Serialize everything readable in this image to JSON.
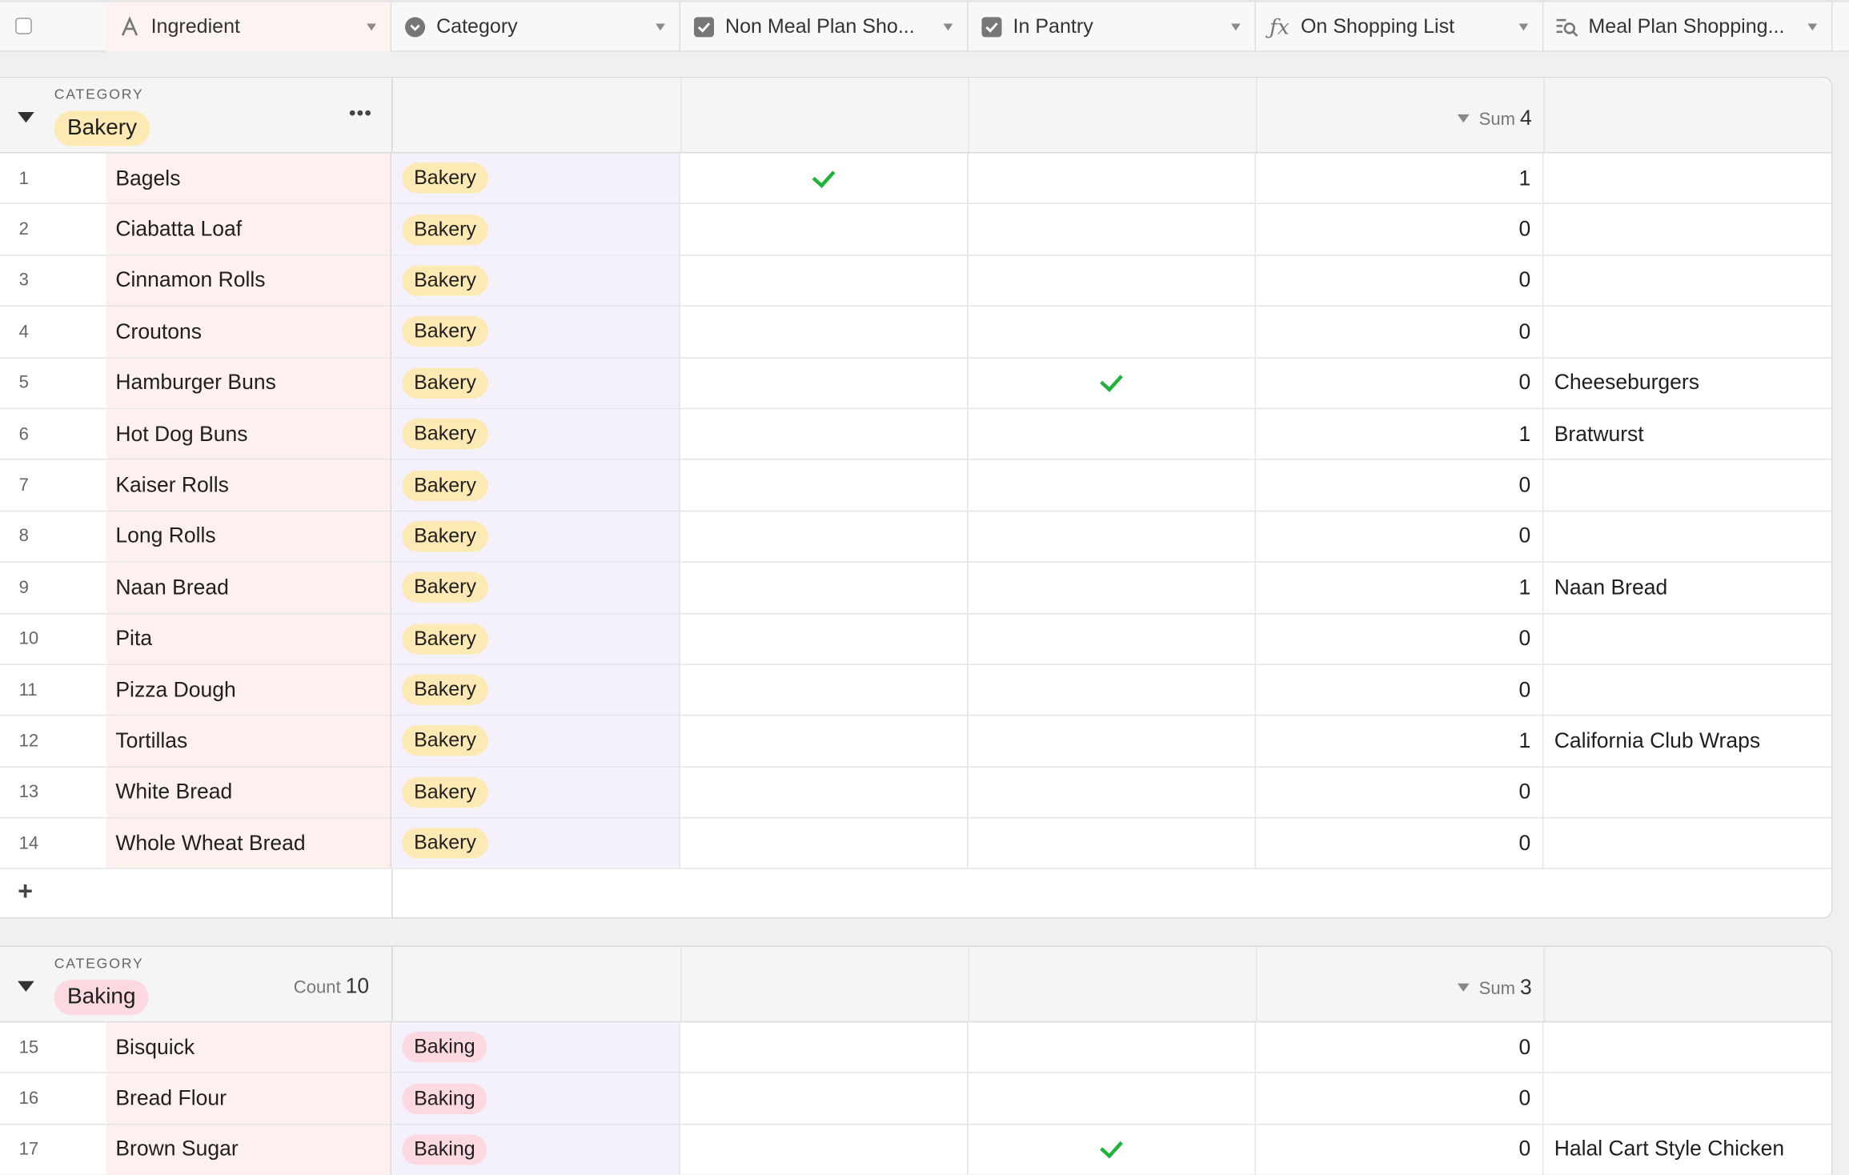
{
  "header": {
    "columns": [
      {
        "label": "Ingredient",
        "icon": "text-field-icon"
      },
      {
        "label": "Category",
        "icon": "single-select-icon"
      },
      {
        "label": "Non Meal Plan Sho...",
        "icon": "checkbox-field-icon"
      },
      {
        "label": "In Pantry",
        "icon": "checkbox-field-icon"
      },
      {
        "label": "On Shopping List",
        "icon": "formula-icon"
      },
      {
        "label": "Meal Plan Shopping...",
        "icon": "lookup-icon"
      }
    ]
  },
  "colors": {
    "bakery_pill": "#fde9b3",
    "baking_pill": "#fcd9e0",
    "check": "#20b33a"
  },
  "groups": [
    {
      "category_label": "CATEGORY",
      "name": "Bakery",
      "pill_color": "#fde9b3",
      "more": "•••",
      "count_label": "",
      "count_value": "",
      "sum_label": "Sum",
      "sum_value": "4",
      "add_label": "+",
      "rows": [
        {
          "num": "1",
          "name": "Bagels",
          "category": "Bakery",
          "non_meal": true,
          "pantry": false,
          "osl": "1",
          "meal_plan": ""
        },
        {
          "num": "2",
          "name": "Ciabatta Loaf",
          "category": "Bakery",
          "non_meal": false,
          "pantry": false,
          "osl": "0",
          "meal_plan": ""
        },
        {
          "num": "3",
          "name": "Cinnamon Rolls",
          "category": "Bakery",
          "non_meal": false,
          "pantry": false,
          "osl": "0",
          "meal_plan": ""
        },
        {
          "num": "4",
          "name": "Croutons",
          "category": "Bakery",
          "non_meal": false,
          "pantry": false,
          "osl": "0",
          "meal_plan": ""
        },
        {
          "num": "5",
          "name": "Hamburger Buns",
          "category": "Bakery",
          "non_meal": false,
          "pantry": true,
          "osl": "0",
          "meal_plan": "Cheeseburgers"
        },
        {
          "num": "6",
          "name": "Hot Dog Buns",
          "category": "Bakery",
          "non_meal": false,
          "pantry": false,
          "osl": "1",
          "meal_plan": "Bratwurst"
        },
        {
          "num": "7",
          "name": "Kaiser Rolls",
          "category": "Bakery",
          "non_meal": false,
          "pantry": false,
          "osl": "0",
          "meal_plan": ""
        },
        {
          "num": "8",
          "name": "Long Rolls",
          "category": "Bakery",
          "non_meal": false,
          "pantry": false,
          "osl": "0",
          "meal_plan": ""
        },
        {
          "num": "9",
          "name": "Naan Bread",
          "category": "Bakery",
          "non_meal": false,
          "pantry": false,
          "osl": "1",
          "meal_plan": "Naan Bread"
        },
        {
          "num": "10",
          "name": "Pita",
          "category": "Bakery",
          "non_meal": false,
          "pantry": false,
          "osl": "0",
          "meal_plan": ""
        },
        {
          "num": "11",
          "name": "Pizza Dough",
          "category": "Bakery",
          "non_meal": false,
          "pantry": false,
          "osl": "0",
          "meal_plan": ""
        },
        {
          "num": "12",
          "name": "Tortillas",
          "category": "Bakery",
          "non_meal": false,
          "pantry": false,
          "osl": "1",
          "meal_plan": "California Club Wraps"
        },
        {
          "num": "13",
          "name": "White Bread",
          "category": "Bakery",
          "non_meal": false,
          "pantry": false,
          "osl": "0",
          "meal_plan": ""
        },
        {
          "num": "14",
          "name": "Whole Wheat Bread",
          "category": "Bakery",
          "non_meal": false,
          "pantry": false,
          "osl": "0",
          "meal_plan": ""
        }
      ]
    },
    {
      "category_label": "CATEGORY",
      "name": "Baking",
      "pill_color": "#fcd9e0",
      "more": "",
      "count_label": "Count",
      "count_value": "10",
      "sum_label": "Sum",
      "sum_value": "3",
      "add_label": "",
      "rows": [
        {
          "num": "15",
          "name": "Bisquick",
          "category": "Baking",
          "non_meal": false,
          "pantry": false,
          "osl": "0",
          "meal_plan": ""
        },
        {
          "num": "16",
          "name": "Bread Flour",
          "category": "Baking",
          "non_meal": false,
          "pantry": false,
          "osl": "0",
          "meal_plan": ""
        },
        {
          "num": "17",
          "name": "Brown Sugar",
          "category": "Baking",
          "non_meal": false,
          "pantry": true,
          "osl": "0",
          "meal_plan": "Halal Cart Style Chicken"
        }
      ]
    }
  ]
}
